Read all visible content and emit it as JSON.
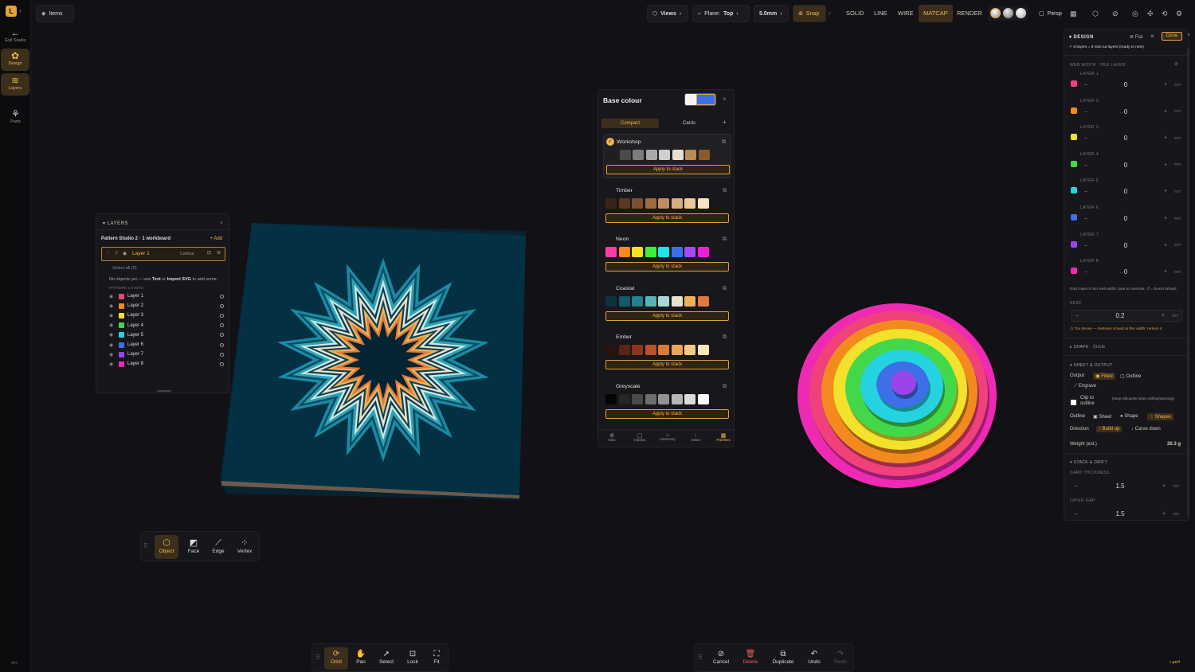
{
  "app": {
    "logo": "L",
    "exit_label": "Exit Studio",
    "version": "dev"
  },
  "rail": [
    {
      "label": "Design",
      "icon": "design-icon"
    },
    {
      "label": "Layers",
      "icon": "layers-icon"
    },
    {
      "label": "Parts",
      "icon": "parts-icon"
    }
  ],
  "topbar": {
    "items_label": "Items",
    "views_label": "Views",
    "plane_label": "Plane:",
    "plane_value": "Top",
    "thickness": "5.0mm",
    "snap_label": "Snap",
    "modes": [
      "SOLID",
      "LINE",
      "WIRE",
      "MATCAP",
      "RENDER"
    ],
    "active_mode": "MATCAP",
    "persp_label": "Persp"
  },
  "layers_panel": {
    "title": "LAYERS",
    "workboard": "Pattern Studio 2 · 1 workboard",
    "add_label": "+ Add",
    "active_layer": "Layer 1",
    "contour_label": "Contour",
    "select_all": "Select all (0)",
    "empty_hint_prefix": "No objects yet — use",
    "empty_hint_text": "Text",
    "empty_hint_or": "or",
    "empty_hint_svg": "Import SVG",
    "empty_hint_suffix": "to add some.",
    "pattern_layers_label": "PATTERN LAYERS",
    "layers": [
      {
        "name": "Layer 1",
        "color": "#f0417a"
      },
      {
        "name": "Layer 2",
        "color": "#f28a1e"
      },
      {
        "name": "Layer 3",
        "color": "#f2e22b"
      },
      {
        "name": "Layer 4",
        "color": "#43d84a"
      },
      {
        "name": "Layer 5",
        "color": "#25d3e0"
      },
      {
        "name": "Layer 6",
        "color": "#3d6fe8"
      },
      {
        "name": "Layer 7",
        "color": "#9a45e8"
      },
      {
        "name": "Layer 8",
        "color": "#ee2ab2"
      }
    ]
  },
  "object_toolbar": [
    {
      "label": "Object",
      "icon": "cube-icon"
    },
    {
      "label": "Face",
      "icon": "face-icon"
    },
    {
      "label": "Edge",
      "icon": "edge-icon"
    },
    {
      "label": "Vertex",
      "icon": "vertex-icon"
    }
  ],
  "nav_toolbar": [
    {
      "label": "Orbit",
      "icon": "orbit-icon"
    },
    {
      "label": "Pan",
      "icon": "hand-icon"
    },
    {
      "label": "Select",
      "icon": "cursor-icon"
    },
    {
      "label": "Lock",
      "icon": "lock-icon"
    },
    {
      "label": "Fit",
      "icon": "fit-icon"
    }
  ],
  "action_toolbar": [
    {
      "label": "Cancel",
      "icon": "cancel-icon"
    },
    {
      "label": "Delete",
      "icon": "trash-icon"
    },
    {
      "label": "Duplicate",
      "icon": "duplicate-icon"
    },
    {
      "label": "Undo",
      "icon": "undo-icon"
    },
    {
      "label": "Redo",
      "icon": "redo-icon"
    }
  ],
  "palette_panel": {
    "title": "Base colour",
    "tabs": [
      "Compact",
      "Cards"
    ],
    "apply_label": "Apply to stack",
    "palettes": [
      {
        "name": "Workshop",
        "colors": [
          "#1f1f1f",
          "#4a4a4a",
          "#7c7c7c",
          "#a9a9a9",
          "#cfcfcf",
          "#e8e0cc",
          "#b88a55",
          "#8a5a2e"
        ]
      },
      {
        "name": "Timber",
        "colors": [
          "#3a2418",
          "#5b3824",
          "#7d5033",
          "#9e6b45",
          "#c08d62",
          "#d8ae82",
          "#ecc99d",
          "#f6e3c1"
        ]
      },
      {
        "name": "Neon",
        "colors": [
          "#ff3aa0",
          "#ff8a1a",
          "#f7e21b",
          "#3df03b",
          "#1de6e6",
          "#3b6ff0",
          "#a349f0",
          "#f01fd2"
        ]
      },
      {
        "name": "Coastal",
        "colors": [
          "#0d3340",
          "#15586b",
          "#23808f",
          "#56b4b4",
          "#a6d9d6",
          "#e7e3c8",
          "#f0b05a",
          "#e27a3c"
        ]
      },
      {
        "name": "Ember",
        "colors": [
          "#2a1410",
          "#5a2418",
          "#8e3320",
          "#b9512a",
          "#d77b3a",
          "#eba45a",
          "#f5c983",
          "#fbe6bc"
        ]
      },
      {
        "name": "Greyscale",
        "colors": [
          "#050505",
          "#262626",
          "#4a4a4a",
          "#6e6e6e",
          "#939393",
          "#b7b7b7",
          "#dbdbdb",
          "#ffffff"
        ]
      }
    ],
    "footer_tabs": [
      "Disc",
      "Classic",
      "Harmony",
      "Value",
      "Palettes"
    ]
  },
  "design_panel": {
    "title": "DESIGN",
    "flat_label": "Flat",
    "done_label": "Done",
    "summary": "8 layers = 8 real cut layers (ready to nest)",
    "web_width_label": "WEB WIDTH · PER LAYER",
    "layer_rows": [
      {
        "label": "LAYER 1",
        "value": "0",
        "color": "#f0417a"
      },
      {
        "label": "LAYER 2",
        "value": "0",
        "color": "#f28a1e"
      },
      {
        "label": "LAYER 3",
        "value": "0",
        "color": "#f2e22b"
      },
      {
        "label": "LAYER 4",
        "value": "0",
        "color": "#43d84a"
      },
      {
        "label": "LAYER 5",
        "value": "0",
        "color": "#25d3e0"
      },
      {
        "label": "LAYER 6",
        "value": "0",
        "color": "#3d6fe8"
      },
      {
        "label": "LAYER 7",
        "value": "0",
        "color": "#9a45e8"
      },
      {
        "label": "LAYER 8",
        "value": "0",
        "color": "#ee2ab2"
      }
    ],
    "unit": "mm",
    "web_hint": "Each layer's min web width; type to override, ↺ = board default.",
    "kerf_label": "KERF",
    "kerf_value": "0.2",
    "warning": "⚠ Too dense — features closed at this width; reduce it",
    "shape_label": "SHAPE · Circle",
    "sheet_output_label": "SHEET & OUTPUT",
    "output_label": "Output",
    "output_filled": "Filled",
    "output_outline": "Outline",
    "engrave_label": "Engrave",
    "clip_label": "Clip to outline",
    "clip_hint": "(keep silhouette when drifting/spinning)",
    "outline_label": "Outline",
    "outline_sheet": "Sheet",
    "outline_shape": "Shape",
    "outline_shapes": "Shapes",
    "direction_label": "Direction",
    "direction_build": "Build up",
    "direction_carve": "Carve down",
    "weight_label": "Weight (est.)",
    "weight_value": "26.3 g",
    "stack_drift_label": "STACK & DRIFT",
    "card_thickness_label": "CARD THICKNESS",
    "card_thickness_value": "1.5",
    "layer_gap_label": "LAYER GAP",
    "layer_gap_value": "1.5"
  },
  "perf_label": "• perf"
}
